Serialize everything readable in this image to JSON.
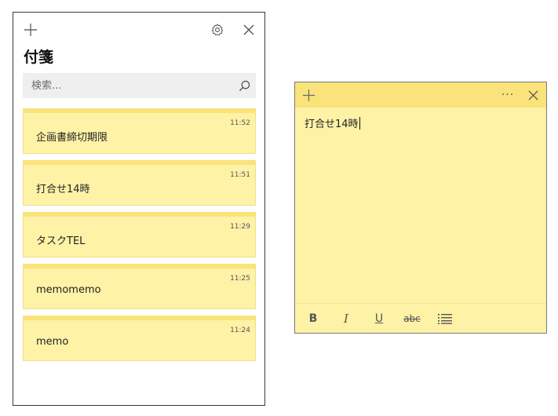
{
  "list_window": {
    "title": "付箋",
    "search": {
      "placeholder": "検索..."
    },
    "notes": [
      {
        "text": "企画書締切期限",
        "time": "11:52"
      },
      {
        "text": "打合せ14時",
        "time": "11:51"
      },
      {
        "text": "タスクTEL",
        "time": "11:29"
      },
      {
        "text": "memomemo",
        "time": "11:25"
      },
      {
        "text": "memo",
        "time": "11:24"
      }
    ]
  },
  "note_window": {
    "content": "打合せ14時",
    "more_label": "···",
    "toolbar": {
      "bold_label": "B",
      "italic_label": "I",
      "underline_label": "U",
      "strike_label": "abc"
    }
  },
  "icons": {
    "add": "plus-icon",
    "settings": "gear-icon",
    "close": "close-icon",
    "search": "search-icon",
    "list": "bulleted-list-icon"
  },
  "colors": {
    "note_body": "#fdf2a6",
    "note_header": "#f9e37a",
    "search_bg": "#efefef"
  }
}
